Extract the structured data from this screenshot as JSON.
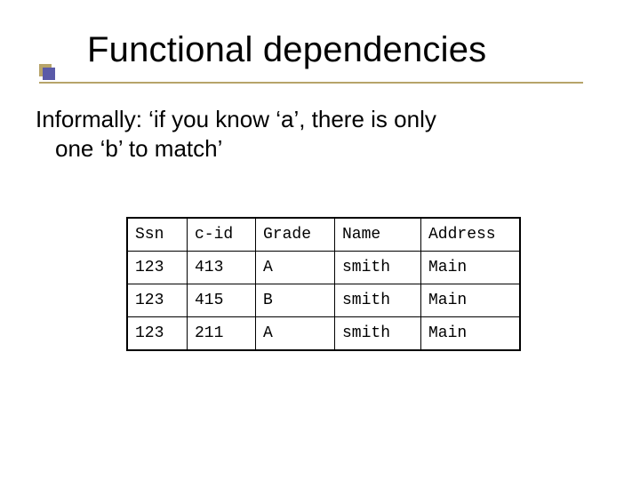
{
  "title": "Functional dependencies",
  "body": {
    "line1": "Informally: ‘if you know ‘a’, there is only",
    "line2": "one ‘b’ to match’"
  },
  "table": {
    "headers": {
      "ssn": "Ssn",
      "cid": "c-id",
      "grade": "Grade",
      "name": "Name",
      "address": "Address"
    },
    "rows": [
      {
        "ssn": "123",
        "cid": "413",
        "grade": "A",
        "name": "smith",
        "address": "Main"
      },
      {
        "ssn": "123",
        "cid": "415",
        "grade": "B",
        "name": "smith",
        "address": "Main"
      },
      {
        "ssn": "123",
        "cid": "211",
        "grade": "A",
        "name": "smith",
        "address": "Main"
      }
    ]
  }
}
